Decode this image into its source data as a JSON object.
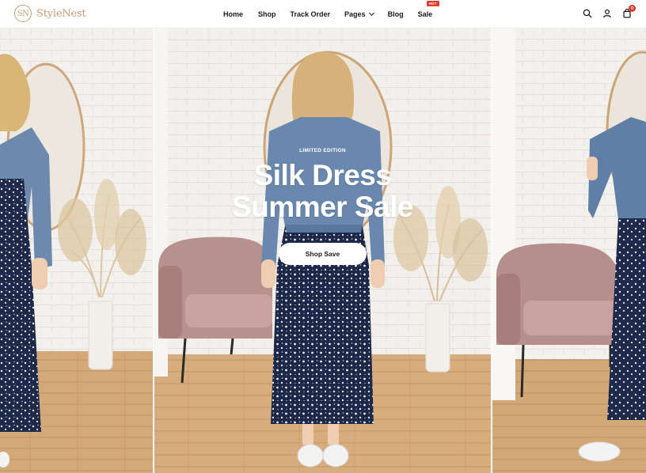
{
  "brand": {
    "logo_mark": "SN",
    "name": "StyleNest"
  },
  "nav": {
    "items": [
      {
        "label": "Home"
      },
      {
        "label": "Shop"
      },
      {
        "label": "Track Order"
      },
      {
        "label": "Pages"
      },
      {
        "label": "Blog"
      },
      {
        "label": "Sale",
        "badge": "HOT"
      }
    ]
  },
  "header_icons": {
    "cart_count": "0",
    "search_icon": "search-icon",
    "account_icon": "user-icon",
    "cart_icon": "cart-icon"
  },
  "hero": {
    "eyebrow": "LIMITED EDITION",
    "headline_line1": "Silk Dress",
    "headline_line2": "Summer Sale",
    "cta_label": "Shop Save"
  },
  "colors": {
    "accent": "#c89a72",
    "badge": "#e03a2f",
    "dress": "#1f2a4a",
    "denim": "#5c7aa0"
  }
}
